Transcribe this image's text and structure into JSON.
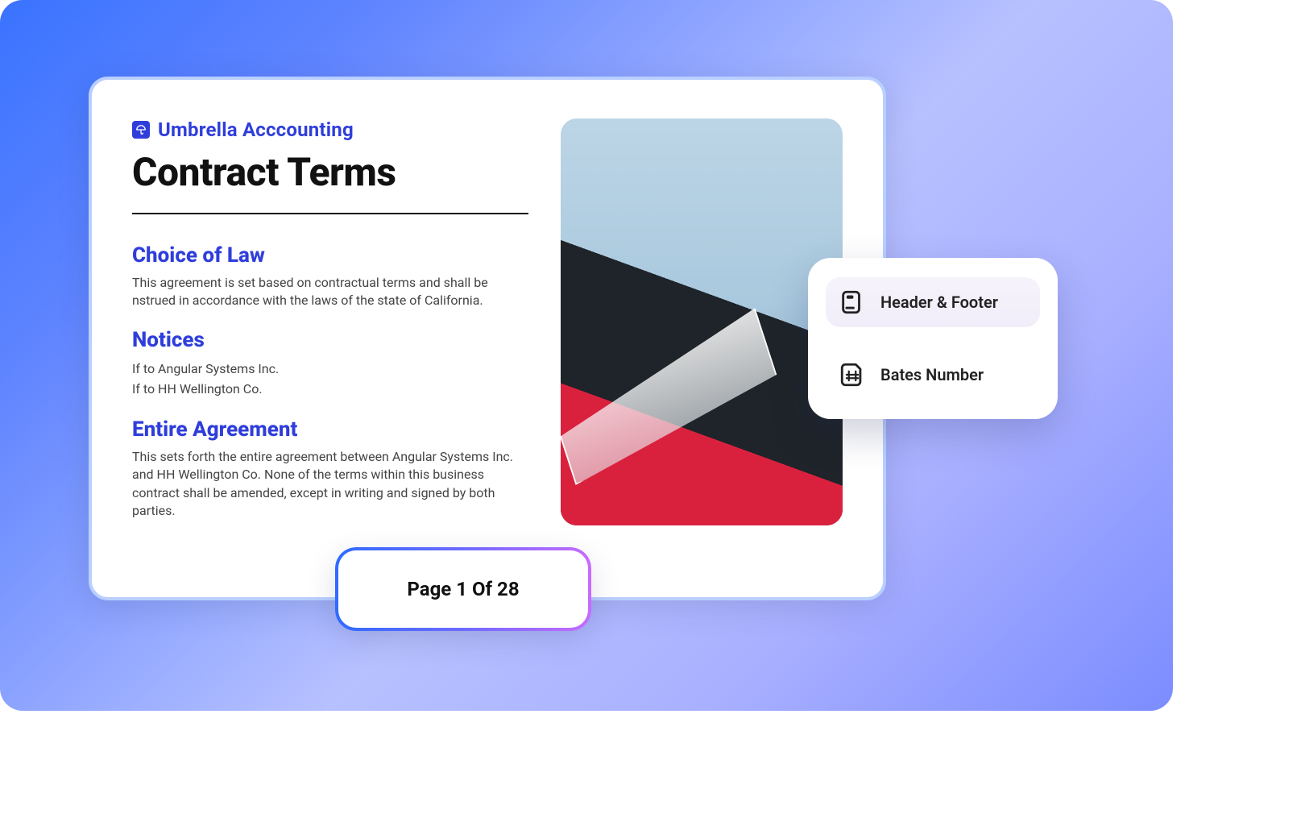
{
  "brand": {
    "name": "Umbrella Acccounting"
  },
  "document": {
    "title": "Contract Terms",
    "sections": [
      {
        "heading": "Choice of Law",
        "body": "This agreement is set based on contractual terms and shall be nstrued in accordance with the laws of the state of California."
      },
      {
        "heading": "Notices",
        "lines": [
          "If to Angular Systems Inc.",
          "If to HH Wellington Co."
        ]
      },
      {
        "heading": "Entire Agreement",
        "body": "This sets forth the entire agreement between Angular Systems Inc. and HH Wellington Co. None of the terms within this business contract shall be amended, except in writing and signed by both parties."
      }
    ]
  },
  "pagination": {
    "label": "Page 1 Of 28",
    "current": 1,
    "total": 28
  },
  "menu": {
    "items": [
      {
        "label": "Header & Footer",
        "icon": "header-footer-icon",
        "active": true
      },
      {
        "label": "Bates Number",
        "icon": "bates-number-icon",
        "active": false
      }
    ]
  },
  "colors": {
    "accent": "#2f3edb",
    "gradient_start": "#3a73ff",
    "gradient_end": "#7b8cff"
  }
}
